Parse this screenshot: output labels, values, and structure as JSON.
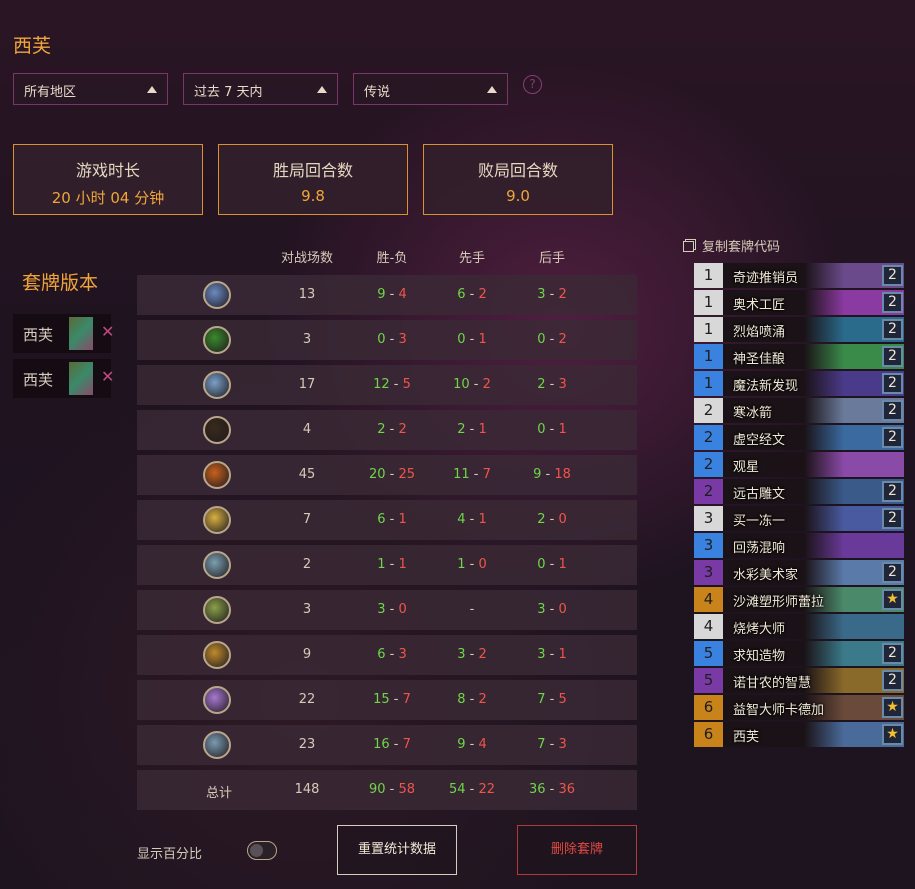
{
  "deck_title": "西芙",
  "filters": {
    "region": "所有地区",
    "period": "过去 7 天内",
    "rank": "传说",
    "help": "?"
  },
  "summary": [
    {
      "label": "游戏时长",
      "value": "20 小时 04 分钟"
    },
    {
      "label": "胜局回合数",
      "value": "9.8"
    },
    {
      "label": "败局回合数",
      "value": "9.0"
    }
  ],
  "versions": {
    "title": "套牌版本",
    "items": [
      {
        "name": "西芙"
      },
      {
        "name": "西芙"
      }
    ]
  },
  "table": {
    "headers": [
      "对战场数",
      "胜-负",
      "先手",
      "后手"
    ],
    "rows": [
      {
        "class_icon": "mage-icon",
        "games": "13",
        "w": "9",
        "l": "4",
        "fw": "6",
        "fl": "2",
        "sw": "3",
        "sl": "2"
      },
      {
        "class_icon": "demon-hunter-icon",
        "games": "3",
        "w": "0",
        "l": "3",
        "fw": "0",
        "fl": "1",
        "sw": "0",
        "sl": "2"
      },
      {
        "class_icon": "death-knight-icon",
        "games": "17",
        "w": "12",
        "l": "5",
        "fw": "10",
        "fl": "2",
        "sw": "2",
        "sl": "3"
      },
      {
        "class_icon": "druid-icon",
        "games": "4",
        "w": "2",
        "l": "2",
        "fw": "2",
        "fl": "1",
        "sw": "0",
        "sl": "1"
      },
      {
        "class_icon": "hunter-icon",
        "games": "45",
        "w": "20",
        "l": "25",
        "fw": "11",
        "fl": "7",
        "sw": "9",
        "sl": "18"
      },
      {
        "class_icon": "paladin-icon",
        "games": "7",
        "w": "6",
        "l": "1",
        "fw": "4",
        "fl": "1",
        "sw": "2",
        "sl": "0"
      },
      {
        "class_icon": "priest-icon",
        "games": "2",
        "w": "1",
        "l": "1",
        "fw": "1",
        "fl": "0",
        "sw": "0",
        "sl": "1"
      },
      {
        "class_icon": "rogue-icon",
        "games": "3",
        "w": "3",
        "l": "0",
        "fw": "-",
        "fl": "",
        "sw": "3",
        "sl": "0"
      },
      {
        "class_icon": "shaman-icon",
        "games": "9",
        "w": "6",
        "l": "3",
        "fw": "3",
        "fl": "2",
        "sw": "3",
        "sl": "1"
      },
      {
        "class_icon": "warlock-icon",
        "games": "22",
        "w": "15",
        "l": "7",
        "fw": "8",
        "fl": "2",
        "sw": "7",
        "sl": "5"
      },
      {
        "class_icon": "warrior-icon",
        "games": "23",
        "w": "16",
        "l": "7",
        "fw": "9",
        "fl": "4",
        "sw": "7",
        "sl": "3"
      }
    ],
    "total": {
      "label": "总计",
      "games": "148",
      "w": "90",
      "l": "58",
      "fw": "54",
      "fl": "22",
      "sw": "36",
      "sl": "36"
    }
  },
  "copy_code": "复制套牌代码",
  "cards": [
    {
      "cost": "1",
      "name": "奇迹推销员",
      "count": "2",
      "rarity": "common"
    },
    {
      "cost": "1",
      "name": "奥术工匠",
      "count": "2",
      "rarity": "common"
    },
    {
      "cost": "1",
      "name": "烈焰喷涌",
      "count": "2",
      "rarity": "common"
    },
    {
      "cost": "1",
      "name": "神圣佳酿",
      "count": "2",
      "rarity": "rare"
    },
    {
      "cost": "1",
      "name": "魔法新发现",
      "count": "2",
      "rarity": "rare"
    },
    {
      "cost": "2",
      "name": "寒冰箭",
      "count": "2",
      "rarity": "common"
    },
    {
      "cost": "2",
      "name": "虚空经文",
      "count": "2",
      "rarity": "rare"
    },
    {
      "cost": "2",
      "name": "观星",
      "count": "",
      "rarity": "rare"
    },
    {
      "cost": "2",
      "name": "远古雕文",
      "count": "2",
      "rarity": "epic"
    },
    {
      "cost": "3",
      "name": "买一冻一",
      "count": "2",
      "rarity": "common"
    },
    {
      "cost": "3",
      "name": "回荡混响",
      "count": "",
      "rarity": "rare"
    },
    {
      "cost": "3",
      "name": "水彩美术家",
      "count": "2",
      "rarity": "epic"
    },
    {
      "cost": "4",
      "name": "沙滩塑形师蕾拉",
      "count": "★",
      "rarity": "legendary"
    },
    {
      "cost": "4",
      "name": "烧烤大师",
      "count": "",
      "rarity": "common"
    },
    {
      "cost": "5",
      "name": "求知造物",
      "count": "2",
      "rarity": "rare"
    },
    {
      "cost": "5",
      "name": "诺甘农的智慧",
      "count": "2",
      "rarity": "epic"
    },
    {
      "cost": "6",
      "name": "益智大师卡德加",
      "count": "★",
      "rarity": "legendary"
    },
    {
      "cost": "6",
      "name": "西芙",
      "count": "★",
      "rarity": "legendary"
    }
  ],
  "footer": {
    "toggle_label": "显示百分比",
    "reset_label": "重置统计数据",
    "delete_label": "删除套牌"
  },
  "colors": {
    "accent": "#f0a53a",
    "win": "#6fd64a",
    "loss": "#f0554a",
    "common": "#d8d8d8",
    "rare": "#3a82e0",
    "epic": "#7a3aa6",
    "legendary": "#c8841a"
  }
}
